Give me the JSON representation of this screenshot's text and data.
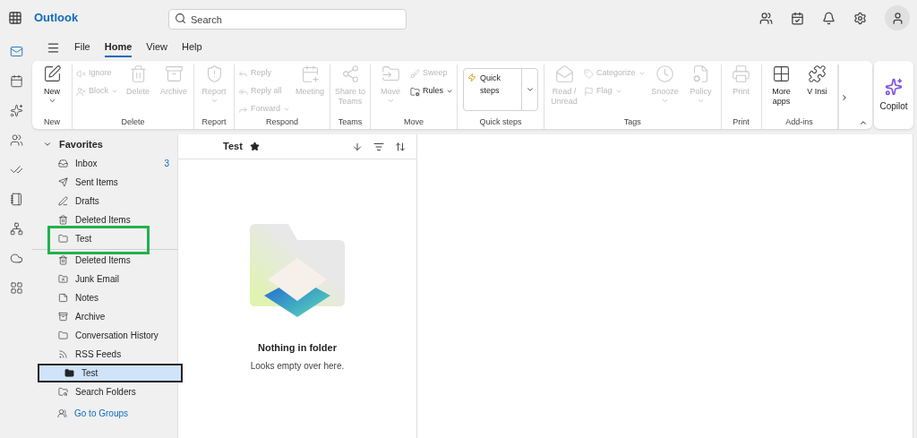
{
  "app": {
    "title": "Outlook"
  },
  "search": {
    "placeholder": "Search"
  },
  "menu_tabs": [
    {
      "label": "File",
      "selected": false
    },
    {
      "label": "Home",
      "selected": true
    },
    {
      "label": "View",
      "selected": false
    },
    {
      "label": "Help",
      "selected": false
    }
  ],
  "ribbon": [
    {
      "label": "New",
      "items": [
        {
          "label": "New",
          "kind": "large",
          "disabled": false,
          "dropdown": true
        }
      ]
    },
    {
      "label": "Delete",
      "items": [
        {
          "label": "Ignore",
          "kind": "small",
          "disabled": true,
          "dropdown": false
        },
        {
          "label": "Block",
          "kind": "small",
          "disabled": true,
          "dropdown": true
        },
        {
          "label": "Delete",
          "kind": "large",
          "disabled": true,
          "dropdown": false
        },
        {
          "label": "Archive",
          "kind": "large",
          "disabled": true,
          "dropdown": false
        }
      ]
    },
    {
      "label": "Report",
      "items": [
        {
          "label": "Report",
          "kind": "large",
          "disabled": true,
          "dropdown": true
        }
      ]
    },
    {
      "label": "Respond",
      "items": [
        {
          "label": "Reply",
          "kind": "small",
          "disabled": true,
          "dropdown": false
        },
        {
          "label": "Reply all",
          "kind": "small",
          "disabled": true,
          "dropdown": false
        },
        {
          "label": "Forward",
          "kind": "small",
          "disabled": true,
          "dropdown": true
        },
        {
          "label": "Meeting",
          "kind": "large",
          "disabled": true,
          "dropdown": false
        }
      ]
    },
    {
      "label": "Teams",
      "items": [
        {
          "label": "Share to Teams",
          "kind": "large",
          "disabled": true,
          "dropdown": false
        }
      ]
    },
    {
      "label": "Move",
      "items": [
        {
          "label": "Move",
          "kind": "large",
          "disabled": true,
          "dropdown": true
        },
        {
          "label": "Sweep",
          "kind": "small",
          "disabled": true,
          "dropdown": false
        },
        {
          "label": "Rules",
          "kind": "small",
          "disabled": false,
          "dropdown": true
        }
      ]
    },
    {
      "label": "Quick steps",
      "items": [
        {
          "label": "Quick steps",
          "kind": "quicksteps",
          "disabled": false,
          "dropdown": true
        }
      ]
    },
    {
      "label": "Tags",
      "items": [
        {
          "label": "Read / Unread",
          "kind": "large",
          "disabled": true,
          "dropdown": false
        },
        {
          "label": "Categorize",
          "kind": "small",
          "disabled": true,
          "dropdown": true
        },
        {
          "label": "Flag",
          "kind": "small",
          "disabled": true,
          "dropdown": true
        },
        {
          "label": "Snooze",
          "kind": "large",
          "disabled": true,
          "dropdown": true
        },
        {
          "label": "Policy",
          "kind": "large",
          "disabled": true,
          "dropdown": true
        }
      ]
    },
    {
      "label": "Print",
      "items": [
        {
          "label": "Print",
          "kind": "large",
          "disabled": true,
          "dropdown": false
        }
      ]
    },
    {
      "label": "Add-ins",
      "items": [
        {
          "label": "More apps",
          "kind": "large",
          "disabled": false,
          "dropdown": false
        },
        {
          "label": "V Insi",
          "kind": "large",
          "disabled": false,
          "dropdown": false
        }
      ]
    }
  ],
  "copilot": {
    "label": "Copilot"
  },
  "favorites": {
    "label": "Favorites",
    "expanded": true,
    "items": [
      {
        "label": "Inbox",
        "count": "3",
        "highlighted": false,
        "selected": false
      },
      {
        "label": "Sent Items",
        "highlighted": false,
        "selected": false
      },
      {
        "label": "Drafts",
        "highlighted": false,
        "selected": false
      },
      {
        "label": "Deleted Items",
        "highlighted": false,
        "selected": false
      },
      {
        "label": "Test",
        "highlighted": true,
        "selected": false
      }
    ]
  },
  "folders": [
    {
      "label": "Deleted Items",
      "selected": false
    },
    {
      "label": "Junk Email",
      "selected": false
    },
    {
      "label": "Notes",
      "selected": false
    },
    {
      "label": "Archive",
      "selected": false
    },
    {
      "label": "Conversation History",
      "selected": false
    },
    {
      "label": "RSS Feeds",
      "selected": false
    },
    {
      "label": "Test",
      "selected": true
    },
    {
      "label": "Search Folders",
      "selected": false
    }
  ],
  "groups_link": "Go to Groups",
  "message_list": {
    "title": "Test",
    "favorite": true,
    "empty_title": "Nothing in folder",
    "empty_subtitle": "Looks empty over here."
  }
}
